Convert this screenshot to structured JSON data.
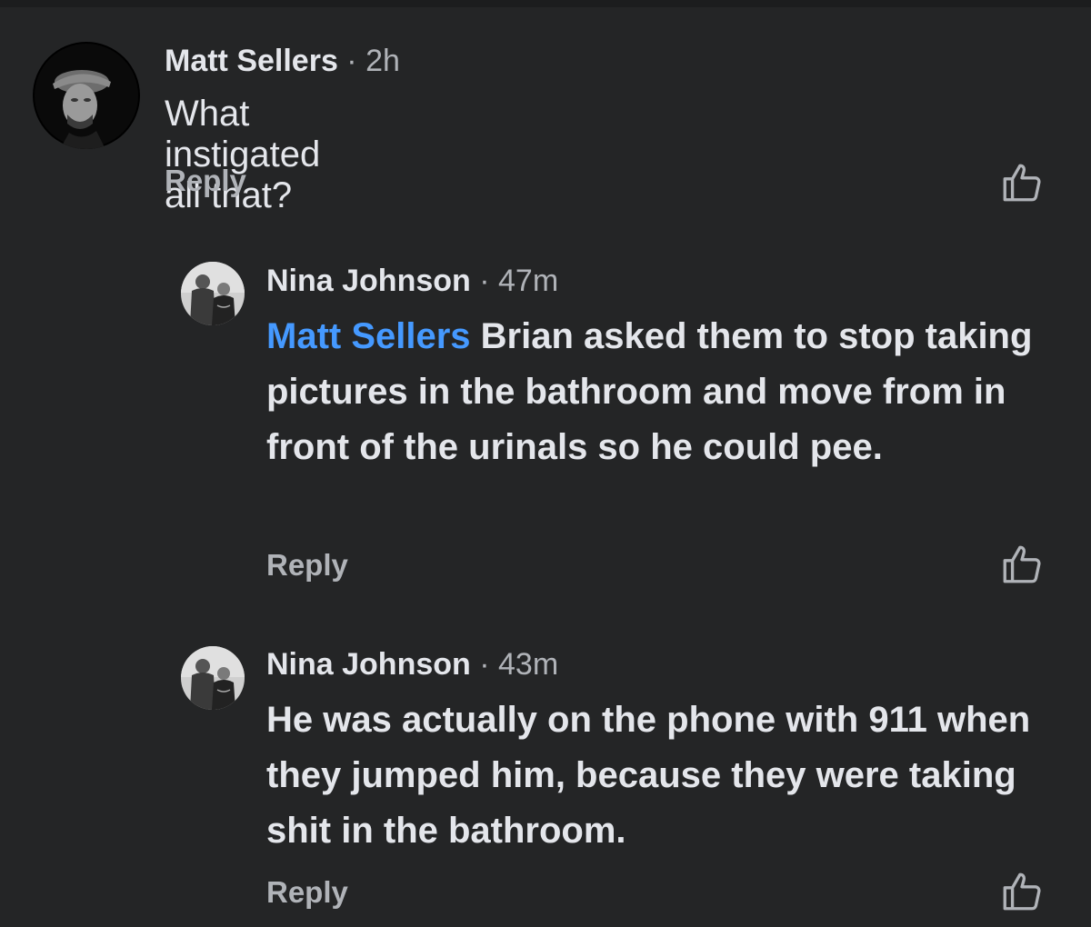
{
  "comments": [
    {
      "author": "Matt Sellers",
      "separator": " · ",
      "time": "2h",
      "text": "What instigated all that?",
      "reply_label": "Reply",
      "avatar_icon": "profile-photo"
    },
    {
      "author": "Nina Johnson",
      "separator": " · ",
      "time": "47m",
      "mention": "Matt Sellers",
      "text": " Brian asked them to stop taking pictures in the bathroom and move from in front of the urinals so he could pee.",
      "reply_label": "Reply",
      "avatar_icon": "profile-photo"
    },
    {
      "author": "Nina Johnson",
      "separator": " · ",
      "time": "43m",
      "text": "He was actually on the phone with 911 when they jumped him, because they were taking shit in the bathroom.",
      "reply_label": "Reply",
      "avatar_icon": "profile-photo"
    }
  ],
  "like_icon": "thumbs-up-icon",
  "colors": {
    "background": "#242526",
    "text": "#e4e6eb",
    "secondary": "#b0b3b8",
    "mention": "#4599ff"
  }
}
